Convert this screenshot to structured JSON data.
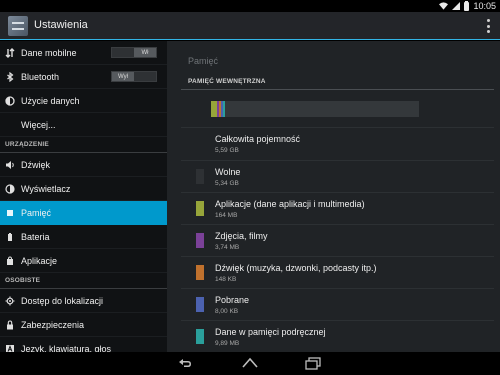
{
  "status": {
    "time": "10:05",
    "icons": [
      "wifi-icon",
      "signal-icon",
      "battery-icon"
    ]
  },
  "actionbar": {
    "title": "Ustawienia",
    "icon": "settings-app-icon",
    "menu_icon": "overflow-menu-icon"
  },
  "sidebar": {
    "items": [
      {
        "label": "Dane mobilne",
        "icon": "mobile-data-icon",
        "toggle": "Wł",
        "toggle_on": true
      },
      {
        "label": "Bluetooth",
        "icon": "bluetooth-icon",
        "toggle": "Wył",
        "toggle_on": false
      },
      {
        "label": "Użycie danych",
        "icon": "data-usage-icon"
      },
      {
        "label": "Więcej..."
      }
    ],
    "section_device": "URZĄDZENIE",
    "device_items": [
      {
        "label": "Dźwięk",
        "icon": "sound-icon"
      },
      {
        "label": "Wyświetlacz",
        "icon": "display-icon"
      },
      {
        "label": "Pamięć",
        "icon": "storage-icon",
        "selected": true
      },
      {
        "label": "Bateria",
        "icon": "battery-icon"
      },
      {
        "label": "Aplikacje",
        "icon": "apps-icon"
      }
    ],
    "section_personal": "OSOBISTE",
    "personal_items": [
      {
        "label": "Dostęp do lokalizacji",
        "icon": "location-icon"
      },
      {
        "label": "Zabezpieczenia",
        "icon": "lock-icon"
      },
      {
        "label": "Język, klawiatura, głos",
        "icon": "language-icon"
      }
    ]
  },
  "main": {
    "title": "Pamięć",
    "category": "PAMIĘĆ WEWNĘTRZNA",
    "entries": [
      {
        "name": "Całkowita pojemność",
        "size": "5,59 GB"
      },
      {
        "name": "Wolne",
        "size": "5,34 GB",
        "color": "#2e3134"
      },
      {
        "name": "Aplikacje (dane aplikacji i multimedia)",
        "size": "164 MB",
        "color": "#97a53a"
      },
      {
        "name": "Zdjęcia, filmy",
        "size": "3,74 MB",
        "color": "#7b4198"
      },
      {
        "name": "Dźwięk (muzyka, dzwonki, podcasty itp.)",
        "size": "148 KB",
        "color": "#c0712d"
      },
      {
        "name": "Pobrane",
        "size": "8,00 KB",
        "color": "#4c62b0"
      },
      {
        "name": "Dane w pamięci podręcznej",
        "size": "9,89 MB",
        "color": "#2a9f9b"
      }
    ],
    "usage_segments": [
      {
        "color": "#97a53a",
        "fraction": 0.029
      },
      {
        "color": "#7b4198",
        "fraction": 0.007
      },
      {
        "color": "#c0712d",
        "fraction": 0.005
      },
      {
        "color": "#4c62b0",
        "fraction": 0.004
      },
      {
        "color": "#2a9f9b",
        "fraction": 0.009
      }
    ]
  },
  "navbar": {
    "buttons": [
      "back-icon",
      "home-icon",
      "recent-apps-icon"
    ]
  },
  "colors": {
    "accent": "#33b5e5",
    "selected": "#0099cc"
  }
}
